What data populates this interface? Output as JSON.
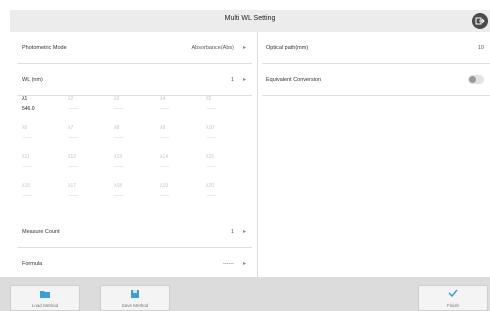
{
  "window": {
    "title": "Multi WL Setting"
  },
  "left": {
    "photometric": {
      "label": "Photometric Mode",
      "value": "Absorbance(Abs)",
      "arrow": "▸"
    },
    "wl": {
      "label": "WL  (nm)",
      "value": "1",
      "arrow": "▸"
    },
    "wavelengths": [
      {
        "label": "λ1",
        "value": "546.0"
      },
      {
        "label": "λ2",
        "value": "------"
      },
      {
        "label": "λ3",
        "value": "------"
      },
      {
        "label": "λ4",
        "value": "------"
      },
      {
        "label": "λ5",
        "value": "------"
      },
      {
        "label": "λ6",
        "value": "------"
      },
      {
        "label": "λ7",
        "value": "------"
      },
      {
        "label": "λ8",
        "value": "------"
      },
      {
        "label": "λ9",
        "value": "------"
      },
      {
        "label": "λ10",
        "value": "------"
      },
      {
        "label": "λ11",
        "value": "------"
      },
      {
        "label": "λ12",
        "value": "------"
      },
      {
        "label": "λ13",
        "value": "------"
      },
      {
        "label": "λ14",
        "value": "------"
      },
      {
        "label": "λ15",
        "value": "------"
      },
      {
        "label": "λ16",
        "value": "------"
      },
      {
        "label": "λ17",
        "value": "------"
      },
      {
        "label": "λ18",
        "value": "------"
      },
      {
        "label": "λ19",
        "value": "------"
      },
      {
        "label": "λ20",
        "value": "------"
      }
    ],
    "measure_count": {
      "label": "Measure Count",
      "value": "1",
      "arrow": "▸"
    },
    "formula": {
      "label": "Formula",
      "value": "------",
      "arrow": "▸"
    }
  },
  "right": {
    "optical_path": {
      "label": "Optical path(mm)",
      "value": "10"
    },
    "equivalent": {
      "label": "Equivalent Conversion",
      "enabled": false
    }
  },
  "footer": {
    "load": "Load Method",
    "save": "Save Method",
    "finish": "Finish"
  },
  "colors": {
    "accent": "#3a9fd8",
    "footer_bg": "#dcdcdc",
    "title_bg": "#ececec"
  }
}
